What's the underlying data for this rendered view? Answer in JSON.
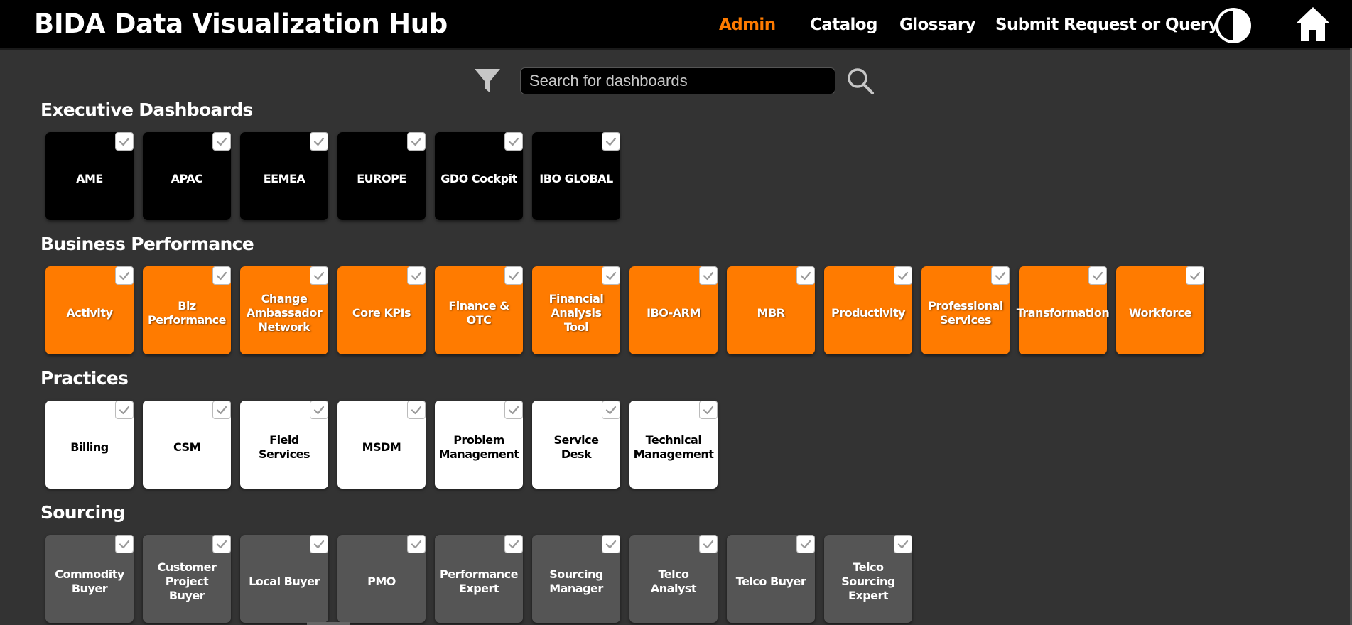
{
  "header": {
    "app_title": "BIDA Data Visualization Hub",
    "nav": [
      {
        "label": "Admin",
        "active": true
      },
      {
        "label": "Catalog"
      },
      {
        "label": "Glossary"
      },
      {
        "label": "Submit Request or Query"
      }
    ],
    "icons": [
      "contrast-icon",
      "home-icon"
    ]
  },
  "search": {
    "placeholder": "Search for dashboards",
    "value": "",
    "icons": [
      "filter-icon",
      "search-icon"
    ]
  },
  "colors": {
    "accent": "#ff7b00",
    "background": "#333333",
    "executive_tile": "#000000",
    "business_tile": "#ff7b00",
    "practices_tile": "#ffffff",
    "sourcing_tile": "#555555"
  },
  "sections": [
    {
      "title": "Executive Dashboards",
      "tiles": [
        "AME",
        "APAC",
        "EEMEA",
        "EUROPE",
        "GDO Cockpit",
        "IBO GLOBAL"
      ]
    },
    {
      "title": "Business Performance",
      "tiles": [
        "Activity",
        "Biz\nPerformance",
        "Change\nAmbassador\nNetwork",
        "Core KPIs",
        "Finance & OTC",
        "Financial\nAnalysis Tool",
        "IBO-ARM",
        "MBR",
        "Productivity",
        "Professional\nServices",
        "Transformation",
        "Workforce"
      ]
    },
    {
      "title": "Practices",
      "tiles": [
        "Billing",
        "CSM",
        "Field Services",
        "MSDM",
        "Problem\nManagement",
        "Service Desk",
        "Technical\nManagement"
      ]
    },
    {
      "title": "Sourcing",
      "tiles": [
        "Commodity\nBuyer",
        "Customer\nProject Buyer",
        "Local Buyer",
        "PMO",
        "Performance\nExpert",
        "Sourcing\nManager",
        "Telco Analyst",
        "Telco Buyer",
        "Telco Sourcing\nExpert"
      ]
    }
  ]
}
